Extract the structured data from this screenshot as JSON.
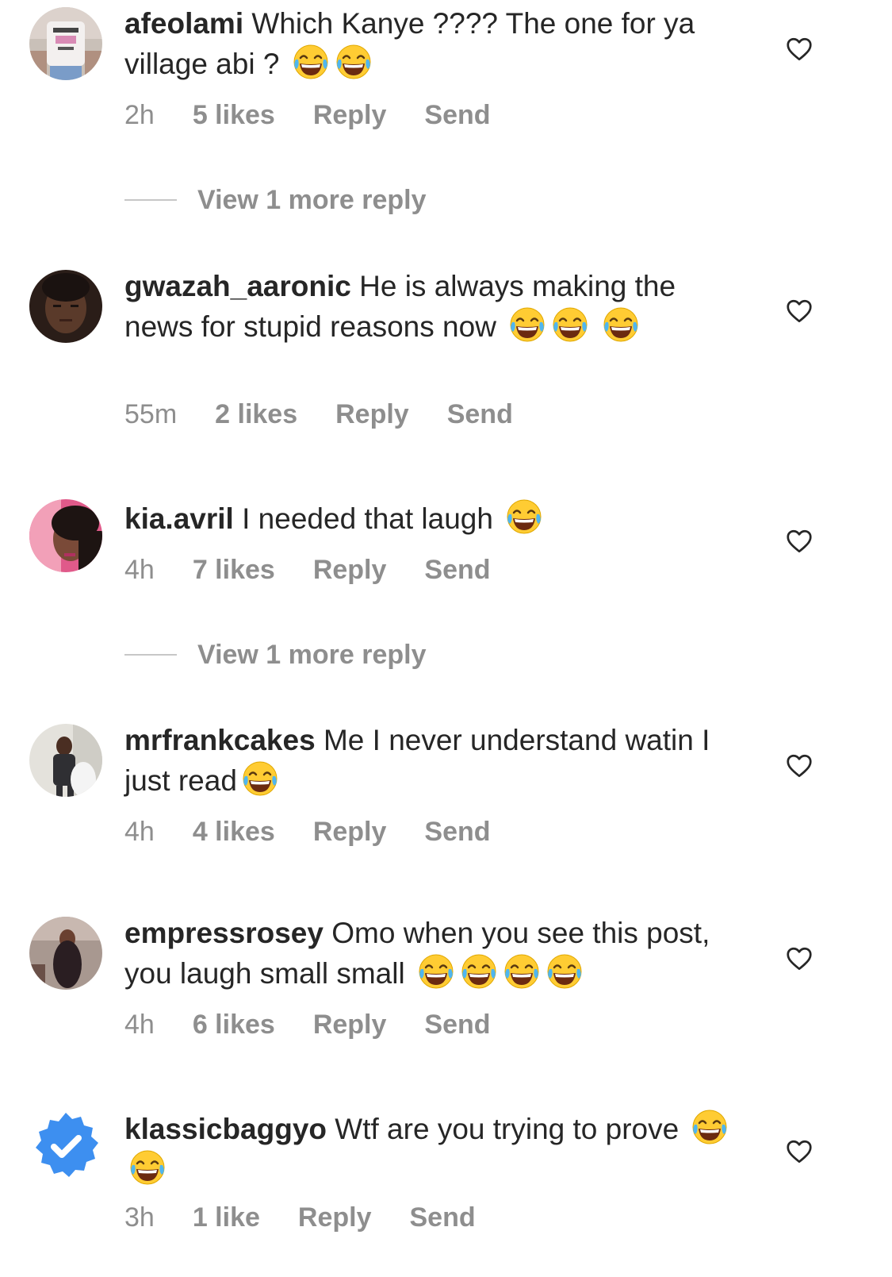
{
  "comments": [
    {
      "username": "afeolami",
      "text": "Which Kanye ???? The one for ya village abi ?",
      "emoji_count": 2,
      "time": "2h",
      "likes": "5 likes",
      "reply": "Reply",
      "send": "Send",
      "avatar_color": "#c9b8a8"
    },
    {
      "username": "gwazah_aaronic",
      "text": "He is always making the news for stupid reasons now",
      "emoji_count": 3,
      "time": "55m",
      "likes": "2 likes",
      "reply": "Reply",
      "send": "Send",
      "avatar_color": "#3a2a22"
    },
    {
      "username": "kia.avril",
      "text": "I needed that laugh",
      "emoji_count": 1,
      "time": "4h",
      "likes": "7 likes",
      "reply": "Reply",
      "send": "Send",
      "avatar_color": "#c0605f"
    },
    {
      "username": "mrfrankcakes",
      "text": "Me I never understand watin I just read",
      "emoji_count": 1,
      "time": "4h",
      "likes": "4 likes",
      "reply": "Reply",
      "send": "Send",
      "avatar_color": "#d8d6d0"
    },
    {
      "username": "empressrosey",
      "text": "Omo when you see this post, you laugh small small",
      "emoji_count": 4,
      "time": "4h",
      "likes": "6 likes",
      "reply": "Reply",
      "send": "Send",
      "avatar_color": "#5a4a45"
    },
    {
      "username": "klassicbaggyo",
      "text": "Wtf are you trying to prove",
      "emoji_count": 2,
      "time": "3h",
      "likes": "1 like",
      "reply": "Reply",
      "send": "Send",
      "avatar_color": "#3d8ff0"
    }
  ],
  "view_more": [
    {
      "label": "View 1 more reply"
    },
    {
      "label": "View 1 more reply"
    }
  ],
  "colors": {
    "text": "#262626",
    "secondary": "#8e8e8e",
    "divider": "#c7c7c7",
    "emoji_face": "#ffcc33"
  },
  "icons": {
    "like": "heart-outline-icon",
    "emoji": "face-with-tears-of-joy-emoji",
    "verified": "verified-badge-icon"
  }
}
